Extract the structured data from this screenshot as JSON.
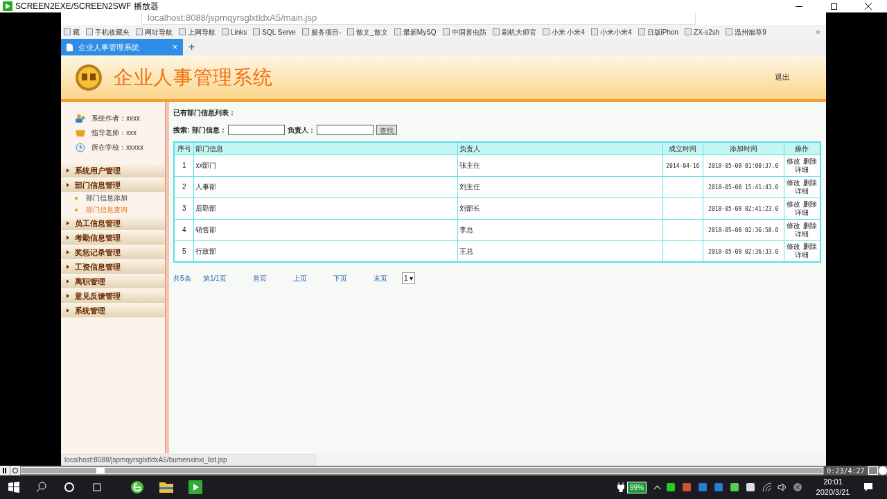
{
  "player_title": "SCREEN2EXE/SCREEN2SWF 播放器",
  "browser": {
    "address": "localhost:8088/jspmqyrsglxtldxA5/main.jsp",
    "bookmarks": [
      "藏",
      "手机收藏夹",
      "网址导航",
      "上网导航",
      "Links",
      "SQL Serve",
      "服务项目-",
      "散文_散文",
      "最新MySQ",
      "中国害虫防",
      "刷机大师官",
      "小米 小米4",
      "小米小米4",
      "日版iPhon",
      "ZX-s2sh",
      "温州烟草9"
    ],
    "more": "»",
    "tabs": [
      {
        "label": "企业人事管理系统",
        "selected": true,
        "close": "×"
      }
    ],
    "new_tab": "+",
    "status_url": "localhost:8088/jspmqyrsglxtldxA5/bumenxinxi_list.jsp"
  },
  "header": {
    "title": "企业人事管理系统",
    "logout": "退出"
  },
  "sidebar": {
    "info": [
      {
        "kind": "author",
        "text": "系统作者：xxxx"
      },
      {
        "kind": "teacher",
        "text": "指导老师：xxx"
      },
      {
        "kind": "school",
        "text": "所在学校：xxxxx"
      }
    ],
    "menu": [
      {
        "label": "系统用户管理"
      },
      {
        "label": "部门信息管理",
        "children": [
          {
            "label": "部门信息添加",
            "selected": false
          },
          {
            "label": "部门信息查询",
            "selected": true
          }
        ]
      },
      {
        "label": "员工信息管理"
      },
      {
        "label": "考勤信息管理"
      },
      {
        "label": "奖惩记录管理"
      },
      {
        "label": "工资信息管理"
      },
      {
        "label": "离职管理"
      },
      {
        "label": "意见反馈管理"
      },
      {
        "label": "系统管理"
      }
    ]
  },
  "content": {
    "heading": "已有部门信息列表：",
    "search_label": "搜索:",
    "fields": [
      {
        "label": "部门信息："
      },
      {
        "label": "负责人："
      }
    ],
    "search_button": "查找",
    "table": {
      "columns": [
        "序号",
        "部门信息",
        "负责人",
        "成立时间",
        "添加时间",
        "操作"
      ],
      "rows": [
        {
          "cells": [
            "1",
            "xx部门",
            "张主任",
            "2014-04-16",
            "2018-05-08 01:00:37.0"
          ],
          "actions": [
            "修改",
            "删除",
            "详细"
          ]
        },
        {
          "cells": [
            "2",
            "人事部",
            "刘主任",
            "",
            "2018-05-08 15:41:43.0"
          ],
          "actions": [
            "修改",
            "删除",
            "详细"
          ]
        },
        {
          "cells": [
            "3",
            "后勤部",
            "刘部长",
            "",
            "2018-05-08 02:41:23.0"
          ],
          "actions": [
            "修改",
            "删除",
            "详细"
          ]
        },
        {
          "cells": [
            "4",
            "销售部",
            "李总",
            "",
            "2018-05-08 02:36:58.0"
          ],
          "actions": [
            "修改",
            "删除",
            "详细"
          ]
        },
        {
          "cells": [
            "5",
            "行政部",
            "王总",
            "",
            "2018-05-08 02:36:33.0"
          ],
          "actions": [
            "修改",
            "删除",
            "详细"
          ]
        }
      ]
    },
    "pager": [
      "共5条",
      "第1/1页",
      "首页",
      "上页",
      "下页",
      "末页"
    ],
    "page_select": "1 ▾"
  },
  "player": {
    "level": 0.094,
    "time": "0:23/4:27"
  },
  "taskbar": {
    "battery": "99%",
    "time": "20:01",
    "date": "2020/3/21"
  }
}
